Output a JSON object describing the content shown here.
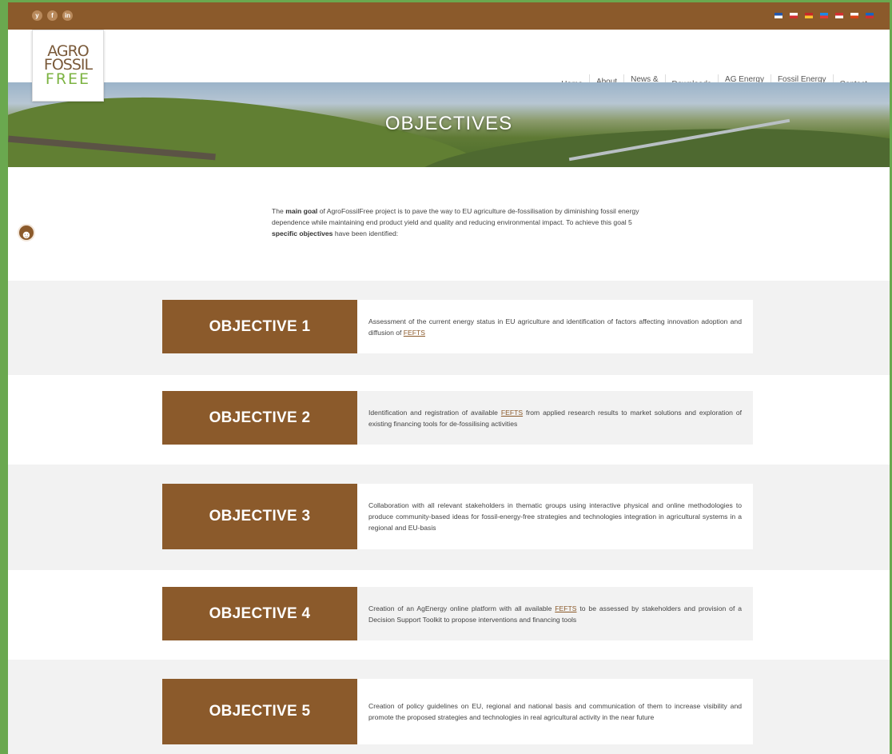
{
  "social": [
    "y",
    "f",
    "in"
  ],
  "flags": [
    {
      "top": "#2255aa",
      "bottom": "#ffffff"
    },
    {
      "top": "#ffffff",
      "bottom": "#d32f2f"
    },
    {
      "top": "#c62828",
      "bottom": "#fbc02d"
    },
    {
      "top": "#1e88e5",
      "bottom": "#e53935"
    },
    {
      "top": "#d32f2f",
      "bottom": "#ffffff"
    },
    {
      "top": "#ffffff",
      "bottom": "#d84315"
    },
    {
      "top": "#1565c0",
      "bottom": "#d32f2f"
    }
  ],
  "logo": {
    "line1": "AGRO",
    "line2": "FOSSIL",
    "line3": "FREE"
  },
  "nav": [
    {
      "label": "Home"
    },
    {
      "label": "About",
      "active": true
    },
    {
      "label": "News &\nEvents"
    },
    {
      "label": "Downloads"
    },
    {
      "label": "AG Energy\nPlatform"
    },
    {
      "label": "Fossil Energy\nFree Cluster"
    },
    {
      "label": "Contact"
    }
  ],
  "hero": {
    "title": "OBJECTIVES"
  },
  "intro": {
    "p1": "The ",
    "b1": "main goal",
    "p2": " of AgroFossilFree project is to pave the way to EU agriculture de-fossilisation by diminishing fossil energy dependence while maintaining end product yield and quality and reducing environmental impact. To achieve this goal 5 ",
    "b2": "specific objectives",
    "p3": " have been identified:"
  },
  "objectives": [
    {
      "label": "OBJECTIVE 1",
      "pre": "Assessment of the current energy status in EU agriculture and identification of factors affecting innovation adoption and diffusion of ",
      "link": "FEFTS",
      "post": ""
    },
    {
      "label": "OBJECTIVE 2",
      "pre": "Identification and registration of available ",
      "link": "FEFTS",
      "post": " from applied research results to market solutions and exploration of existing financing tools for de-fossilising activities"
    },
    {
      "label": "OBJECTIVE 3",
      "pre": "Collaboration with all relevant stakeholders in thematic groups using interactive physical and online methodologies to produce community-based ideas for fossil-energy-free strategies and technologies integration in agricultural systems in a regional and EU-basis",
      "link": "",
      "post": ""
    },
    {
      "label": "OBJECTIVE 4",
      "pre": "Creation of an AgEnergy online platform with all available ",
      "link": "FEFTS",
      "post": " to be assessed by stakeholders and provision of a Decision Support Toolkit to propose interventions and financing tools"
    },
    {
      "label": "OBJECTIVE 5",
      "pre": "Creation of policy guidelines on EU, regional and national basis and communication of them to increase visibility and promote the proposed strategies and technologies in real agricultural activity in the near future",
      "link": "",
      "post": ""
    }
  ],
  "colors": {
    "brand_brown": "#8b5a2b",
    "brand_green": "#7cb342",
    "frame_green": "#6aa84f"
  }
}
